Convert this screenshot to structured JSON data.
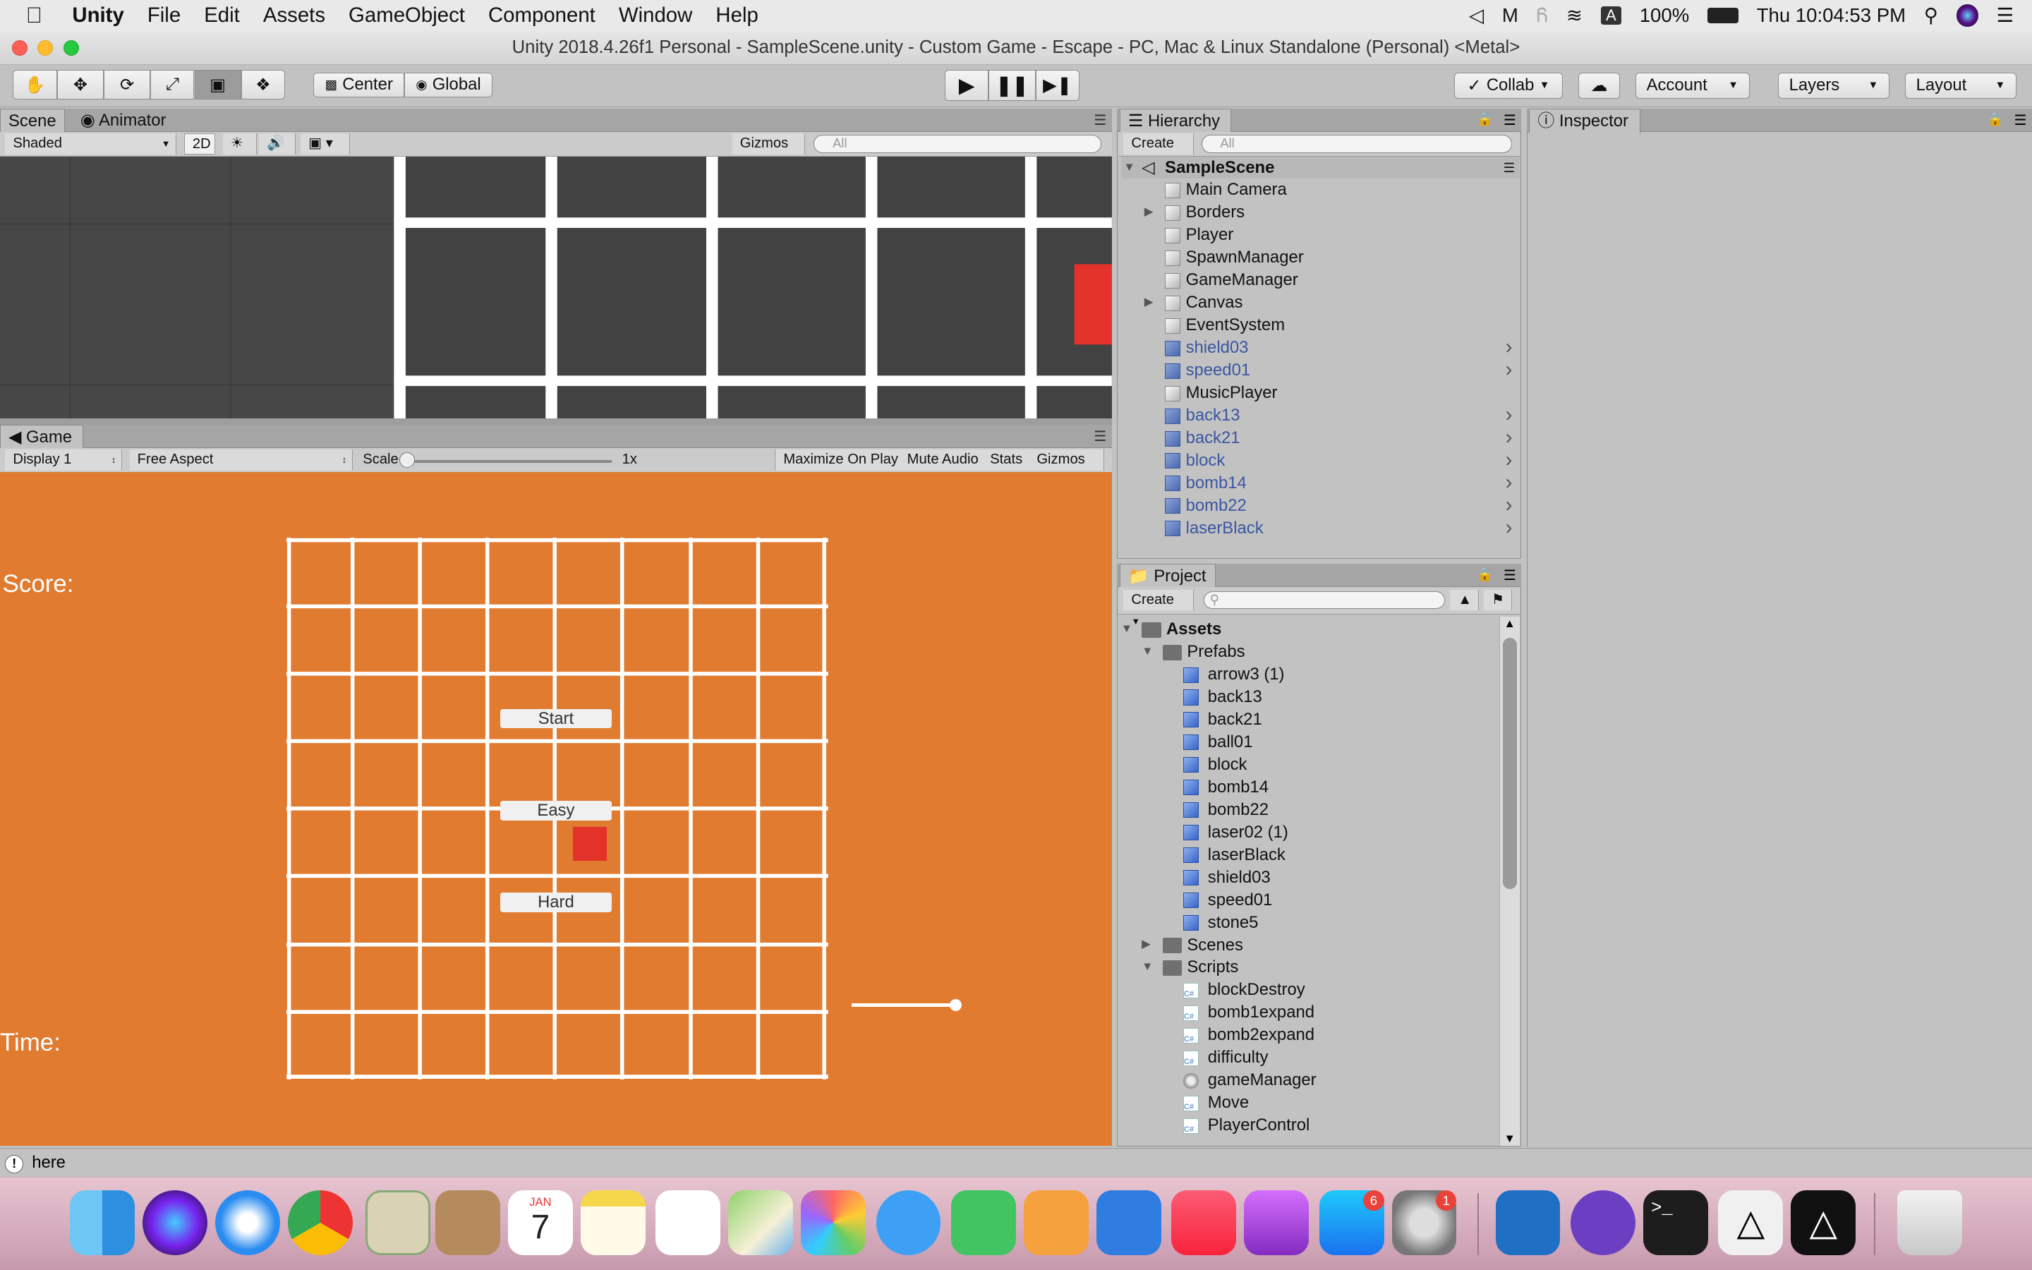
{
  "menubar": {
    "app": "Unity",
    "items": [
      "File",
      "Edit",
      "Assets",
      "GameObject",
      "Component",
      "Window",
      "Help"
    ],
    "battery": "100%",
    "clock": "Thu 10:04:53 PM"
  },
  "window": {
    "title": "Unity 2018.4.26f1 Personal - SampleScene.unity - Custom Game - Escape - PC, Mac & Linux Standalone (Personal) <Metal>"
  },
  "toolbar": {
    "pivot": "Center",
    "space": "Global",
    "collab": "Collab",
    "account": "Account",
    "layers": "Layers",
    "layout": "Layout"
  },
  "scene": {
    "tab_scene": "Scene",
    "tab_animator": "Animator",
    "shading": "Shaded",
    "mode2d": "2D",
    "gizmos": "Gizmos",
    "search_placeholder": "All"
  },
  "game": {
    "tab": "Game",
    "display": "Display 1",
    "aspect": "Free Aspect",
    "scale_label": "Scale",
    "scale_value": "1x",
    "maximize": "Maximize On Play",
    "mute": "Mute Audio",
    "stats": "Stats",
    "gizmos": "Gizmos",
    "score_label": "Score:",
    "time_label": "Time:",
    "start_button": "Start",
    "easy_button": "Easy",
    "hard_button": "Hard"
  },
  "hierarchy": {
    "tab": "Hierarchy",
    "create": "Create",
    "search_placeholder": "All",
    "scene_name": "SampleScene",
    "items": [
      {
        "label": "Main Camera",
        "prefab": false,
        "expandable": false
      },
      {
        "label": "Borders",
        "prefab": false,
        "expandable": true
      },
      {
        "label": "Player",
        "prefab": false,
        "expandable": false
      },
      {
        "label": "SpawnManager",
        "prefab": false,
        "expandable": false
      },
      {
        "label": "GameManager",
        "prefab": false,
        "expandable": false
      },
      {
        "label": "Canvas",
        "prefab": false,
        "expandable": true
      },
      {
        "label": "EventSystem",
        "prefab": false,
        "expandable": false
      },
      {
        "label": "shield03",
        "prefab": true,
        "expandable": false
      },
      {
        "label": "speed01",
        "prefab": true,
        "expandable": false
      },
      {
        "label": "MusicPlayer",
        "prefab": false,
        "expandable": false
      },
      {
        "label": "back13",
        "prefab": true,
        "expandable": false
      },
      {
        "label": "back21",
        "prefab": true,
        "expandable": false
      },
      {
        "label": "block",
        "prefab": true,
        "expandable": false
      },
      {
        "label": "bomb14",
        "prefab": true,
        "expandable": false
      },
      {
        "label": "bomb22",
        "prefab": true,
        "expandable": false
      },
      {
        "label": "laserBlack",
        "prefab": true,
        "expandable": false
      }
    ]
  },
  "inspector": {
    "tab": "Inspector"
  },
  "project": {
    "tab": "Project",
    "create": "Create",
    "assets": "Assets",
    "prefabs_folder": "Prefabs",
    "prefabs": [
      "arrow3 (1)",
      "back13",
      "back21",
      "ball01",
      "block",
      "bomb14",
      "bomb22",
      "laser02 (1)",
      "laserBlack",
      "shield03",
      "speed01",
      "stone5"
    ],
    "scenes_folder": "Scenes",
    "scripts_folder": "Scripts",
    "scripts": [
      "blockDestroy",
      "bomb1expand",
      "bomb2expand",
      "difficulty",
      "gameManager",
      "Move",
      "PlayerControl"
    ]
  },
  "statusbar": {
    "message": "here"
  },
  "dock": {
    "calendar_month": "JAN",
    "calendar_day": "7",
    "appstore_badge": "6",
    "prefs_badge": "1"
  }
}
